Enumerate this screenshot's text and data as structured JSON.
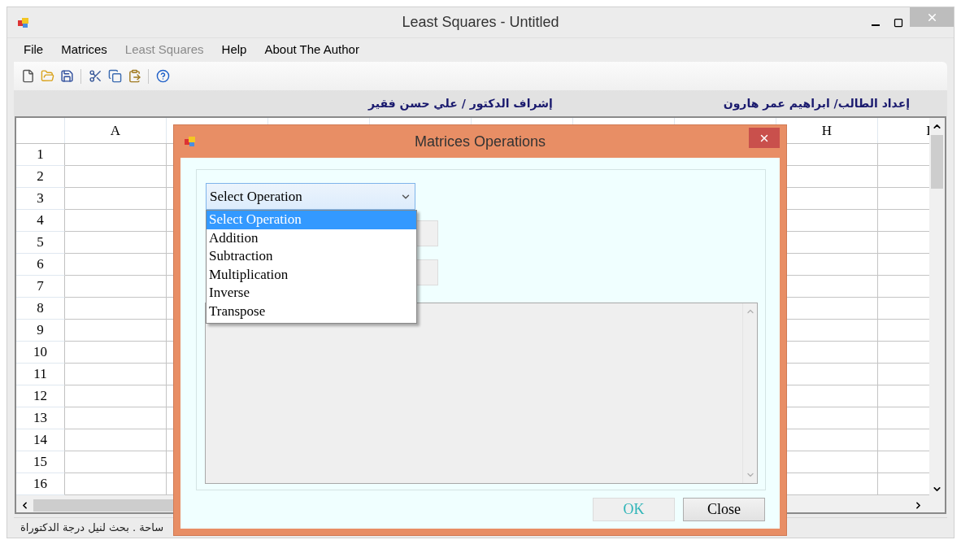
{
  "window": {
    "title": "Least Squares - Untitled"
  },
  "menu": [
    {
      "label": "File",
      "disabled": false
    },
    {
      "label": "Matrices",
      "disabled": false
    },
    {
      "label": "Least Squares",
      "disabled": true
    },
    {
      "label": "Help",
      "disabled": false
    },
    {
      "label": "About The Author",
      "disabled": false
    }
  ],
  "toolbar": [
    {
      "kind": "new"
    },
    {
      "kind": "open"
    },
    {
      "kind": "save"
    },
    {
      "kind": "separator"
    },
    {
      "kind": "cut"
    },
    {
      "kind": "copy"
    },
    {
      "kind": "paste"
    },
    {
      "kind": "separator"
    },
    {
      "kind": "help"
    }
  ],
  "header": {
    "supervisor": "إشراف الدكتور / علي حسن فقير",
    "student": "إعداد الطالب/ ابراهيم عمر هارون"
  },
  "grid": {
    "columns": [
      {
        "label": "A"
      },
      {},
      {},
      {},
      {},
      {},
      {},
      {
        "label": "H"
      },
      {
        "label": "I"
      }
    ],
    "rows": [
      "1",
      "2",
      "3",
      "4",
      "5",
      "6",
      "7",
      "8",
      "9",
      "10",
      "11",
      "12",
      "13",
      "14",
      "15",
      "16"
    ]
  },
  "status_bar": {
    "text": "ساحة . بحث لنيل درجة الدكتوراة"
  },
  "dialog": {
    "title": "Matrices Operations",
    "operation": {
      "value": "Select Operation",
      "expanded": true,
      "options": [
        {
          "label": "Select Operation",
          "selected": true
        },
        {
          "label": "Addition",
          "selected": false
        },
        {
          "label": "Subtraction",
          "selected": false
        },
        {
          "label": "Multiplication",
          "selected": false
        },
        {
          "label": "Inverse",
          "selected": false
        },
        {
          "label": "Transpose",
          "selected": false
        }
      ]
    },
    "fields": [
      {
        "disabled": true
      },
      {
        "disabled": true
      }
    ],
    "output": {
      "disabled": true
    },
    "buttons": [
      {
        "label": "OK",
        "disabled": true
      },
      {
        "label": "Close",
        "disabled": false
      }
    ]
  }
}
